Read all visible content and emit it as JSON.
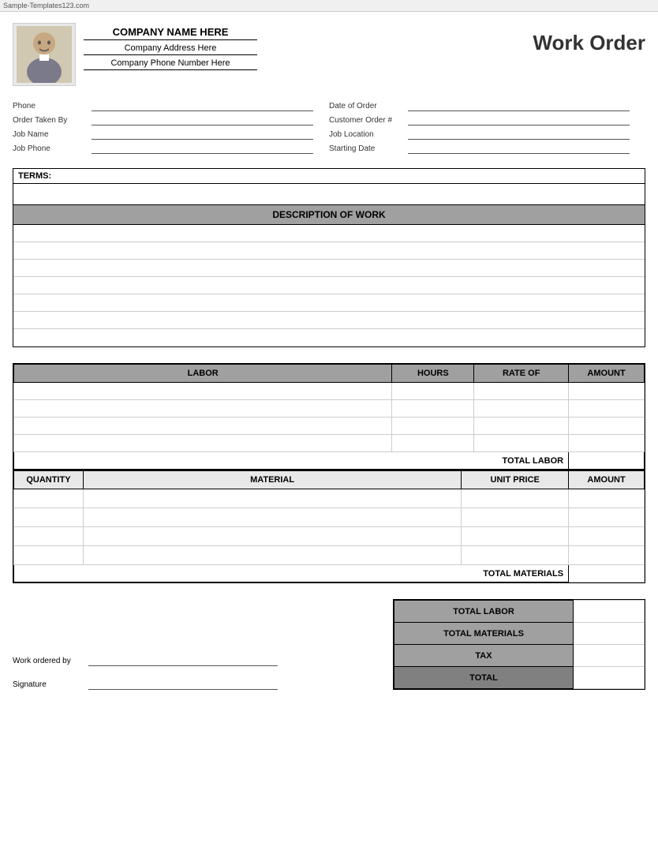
{
  "watermark": "Sample-Templates123.com",
  "header": {
    "company_name": "COMPANY NAME HERE",
    "company_address": "Company Address Here",
    "company_phone": "Company Phone Number Here",
    "title": "Work Order"
  },
  "form": {
    "phone_label": "Phone",
    "order_taken_label": "Order Taken By",
    "job_name_label": "Job Name",
    "job_phone_label": "Job Phone",
    "date_order_label": "Date of Order",
    "customer_order_label": "Customer Order #",
    "job_location_label": "Job Location",
    "starting_date_label": "Starting Date"
  },
  "terms": {
    "label": "TERMS:"
  },
  "description": {
    "header": "DESCRIPTION OF WORK",
    "rows": 7
  },
  "labor": {
    "col_labor": "LABOR",
    "col_hours": "HOURS",
    "col_rate": "RATE OF",
    "col_amount": "AMOUNT",
    "rows": 4,
    "total_label": "TOTAL LABOR"
  },
  "materials": {
    "col_qty": "QUANTITY",
    "col_material": "MATERIAL",
    "col_unit_price": "UNIT PRICE",
    "col_amount": "AMOUNT",
    "rows": 4,
    "total_label": "TOTAL MATERIALS"
  },
  "summary": {
    "total_labor": "TOTAL LABOR",
    "total_materials": "TOTAL MATERIALS",
    "tax": "TAX",
    "total": "TOTAL"
  },
  "bottom": {
    "work_ordered_by": "Work ordered by",
    "signature": "Signature"
  }
}
